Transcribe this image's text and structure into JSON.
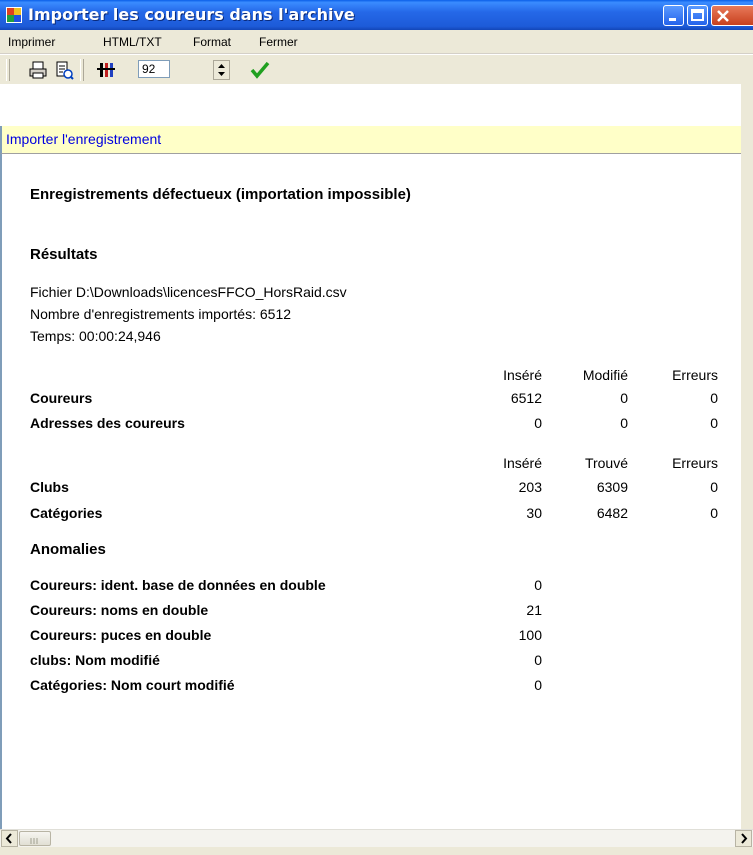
{
  "window": {
    "title": "Importer les coureurs dans l'archive"
  },
  "menu": {
    "items": [
      "Imprimer",
      "HTML/TXT",
      "Format",
      "Fermer"
    ]
  },
  "toolbar": {
    "zoom_value": "92"
  },
  "action": {
    "label": "Importer l'enregistrement"
  },
  "report": {
    "defective_heading": "Enregistrements défectueux (importation impossible)",
    "results_heading": "Résultats",
    "file_line": "Fichier D:\\Downloads\\licencesFFCO_HorsRaid.csv",
    "count_line": "Nombre d'enregistrements importés: 6512",
    "time_line": "Temps: 00:00:24,946",
    "table1": {
      "headers": [
        "Inséré",
        "Modifié",
        "Erreurs"
      ],
      "rows": [
        {
          "label": "Coureurs",
          "values": [
            "6512",
            "0",
            "0"
          ]
        },
        {
          "label": "Adresses des coureurs",
          "values": [
            "0",
            "0",
            "0"
          ]
        }
      ]
    },
    "table2": {
      "headers": [
        "Inséré",
        "Trouvé",
        "Erreurs"
      ],
      "rows": [
        {
          "label": "Clubs",
          "values": [
            "203",
            "6309",
            "0"
          ]
        },
        {
          "label": "Catégories",
          "values": [
            "30",
            "6482",
            "0"
          ]
        }
      ]
    },
    "anomalies_heading": "Anomalies",
    "anomalies": [
      {
        "label": "Coureurs: ident. base de données en double",
        "value": "0"
      },
      {
        "label": "Coureurs: noms en double",
        "value": "21"
      },
      {
        "label": "Coureurs: puces en double",
        "value": "100"
      },
      {
        "label": "clubs: Nom modifié",
        "value": "0"
      },
      {
        "label": "Catégories: Nom court modifié",
        "value": "0"
      }
    ]
  }
}
